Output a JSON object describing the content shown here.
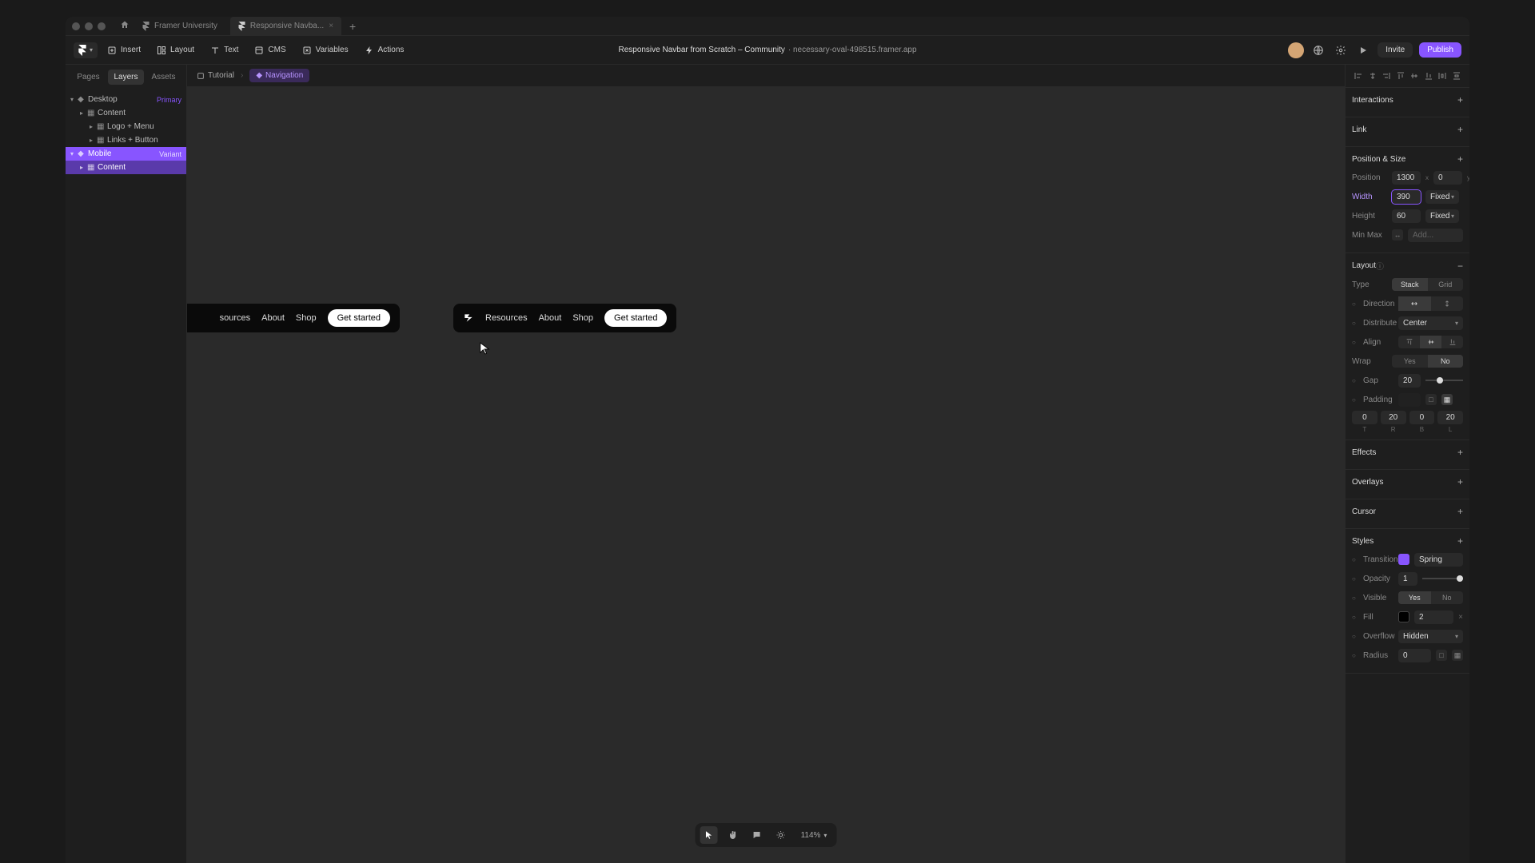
{
  "titlebar": {
    "tabs": [
      {
        "label": "Framer University"
      },
      {
        "label": "Responsive Navba..."
      }
    ]
  },
  "toolbar": {
    "insert": "Insert",
    "layout": "Layout",
    "text": "Text",
    "cms": "CMS",
    "variables": "Variables",
    "actions": "Actions",
    "title_bold": "Responsive Navbar from Scratch – Community",
    "title_rest": "· necessary-oval-498515.framer.app",
    "invite": "Invite",
    "publish": "Publish"
  },
  "leftPanel": {
    "tabs": {
      "pages": "Pages",
      "layers": "Layers",
      "assets": "Assets"
    },
    "tree": {
      "desktop": "Desktop",
      "desktop_badge": "Primary",
      "content1": "Content",
      "logo_menu": "Logo + Menu",
      "links_button": "Links + Button",
      "mobile": "Mobile",
      "mobile_badge": "Variant",
      "content2": "Content"
    }
  },
  "breadcrumbs": {
    "tutorial": "Tutorial",
    "navigation": "Navigation"
  },
  "canvas": {
    "nav": {
      "resources_partial": "sources",
      "resources": "Resources",
      "about": "About",
      "shop": "Shop",
      "cta": "Get started"
    },
    "zoom": "114%"
  },
  "rightPanel": {
    "interactions": "Interactions",
    "link": "Link",
    "positionSize": {
      "title": "Position & Size",
      "position": "Position",
      "pos_x": "1300",
      "pos_y": "0",
      "width_label": "Width",
      "width": "390",
      "width_mode": "Fixed",
      "height_label": "Height",
      "height": "60",
      "height_mode": "Fixed",
      "minmax_label": "Min Max",
      "minmax_val": "Add..."
    },
    "layout": {
      "title": "Layout",
      "type_label": "Type",
      "type_stack": "Stack",
      "type_grid": "Grid",
      "direction": "Direction",
      "distribute": "Distribute",
      "distribute_val": "Center",
      "align": "Align",
      "wrap": "Wrap",
      "wrap_yes": "Yes",
      "wrap_no": "No",
      "gap": "Gap",
      "gap_val": "20",
      "padding": "Padding",
      "pad_t": "0",
      "pad_r": "20",
      "pad_b": "0",
      "pad_l": "20",
      "pad_tl": "T",
      "pad_rl": "R",
      "pad_bl": "B",
      "pad_ll": "L"
    },
    "effects": "Effects",
    "overlays": "Overlays",
    "cursor": "Cursor",
    "styles": {
      "title": "Styles",
      "transition": "Transition",
      "transition_val": "Spring",
      "opacity": "Opacity",
      "opacity_val": "1",
      "visible": "Visible",
      "visible_yes": "Yes",
      "visible_no": "No",
      "fill": "Fill",
      "fill_val": "2",
      "overflow": "Overflow",
      "overflow_val": "Hidden",
      "radius": "Radius",
      "radius_val": "0"
    }
  }
}
